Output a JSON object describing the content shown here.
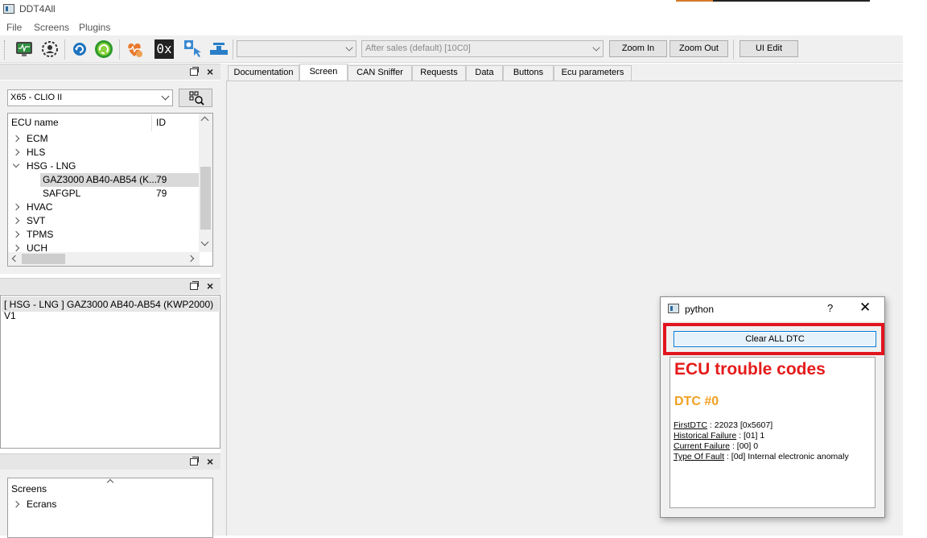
{
  "window": {
    "title": "DDT4All"
  },
  "menu": [
    "File",
    "Screens",
    "Plugins"
  ],
  "toolbar": {
    "icons": [
      "monitor-icon",
      "gear-person-icon",
      "refresh-icon",
      "circular-arrows-icon",
      "heart-pulse-icon",
      "hex-icon",
      "settings-touch-icon",
      "valve-icon"
    ],
    "hex_label": "0x",
    "combo1_value": "",
    "combo2_value": "After sales (default) [10C0]",
    "zoom_in": "Zoom In",
    "zoom_out": "Zoom Out",
    "ui_edit": "UI Edit"
  },
  "vehicle_panel": {
    "vehicle": "X65 - CLIO II",
    "columns": {
      "name": "ECU name",
      "id": "ID"
    },
    "rows": [
      {
        "label": "ECM",
        "id": ""
      },
      {
        "label": "HLS",
        "id": ""
      },
      {
        "label": "HSG - LNG",
        "id": ""
      },
      {
        "label": "GAZ3000 AB40-AB54 (K...",
        "id": "79"
      },
      {
        "label": "SAFGPL",
        "id": "79"
      },
      {
        "label": "HVAC",
        "id": ""
      },
      {
        "label": "SVT",
        "id": ""
      },
      {
        "label": "TPMS",
        "id": ""
      },
      {
        "label": "UCH",
        "id": ""
      }
    ]
  },
  "ecu_panel": {
    "selected": "[ HSG - LNG ] GAZ3000 AB40-AB54 (KWP2000) V1"
  },
  "screens_panel": {
    "header": "Screens",
    "items": [
      "Ecrans"
    ]
  },
  "tabs": [
    "Documentation",
    "Screen",
    "CAN Sniffer",
    "Requests",
    "Data",
    "Buttons",
    "Ecu parameters"
  ],
  "active_tab": "Screen",
  "dialog": {
    "title": "python",
    "help": "?",
    "close": "✕",
    "button": "Clear ALL DTC",
    "heading": "ECU trouble codes",
    "dtc_title": "DTC #0",
    "fields": [
      {
        "label": "FirstDTC",
        "value": " : 22023 [0x5607]"
      },
      {
        "label": "Historical Failure",
        "value": " : [01] 1"
      },
      {
        "label": "Current Failure",
        "value": " : [00] 0"
      },
      {
        "label": "Type Of Fault",
        "value": " : [0d] Internal electronic anomaly"
      }
    ],
    "colors": {
      "heading": "#e51b1b",
      "dtc": "#f0a020",
      "highlight": "#e1141e"
    }
  }
}
